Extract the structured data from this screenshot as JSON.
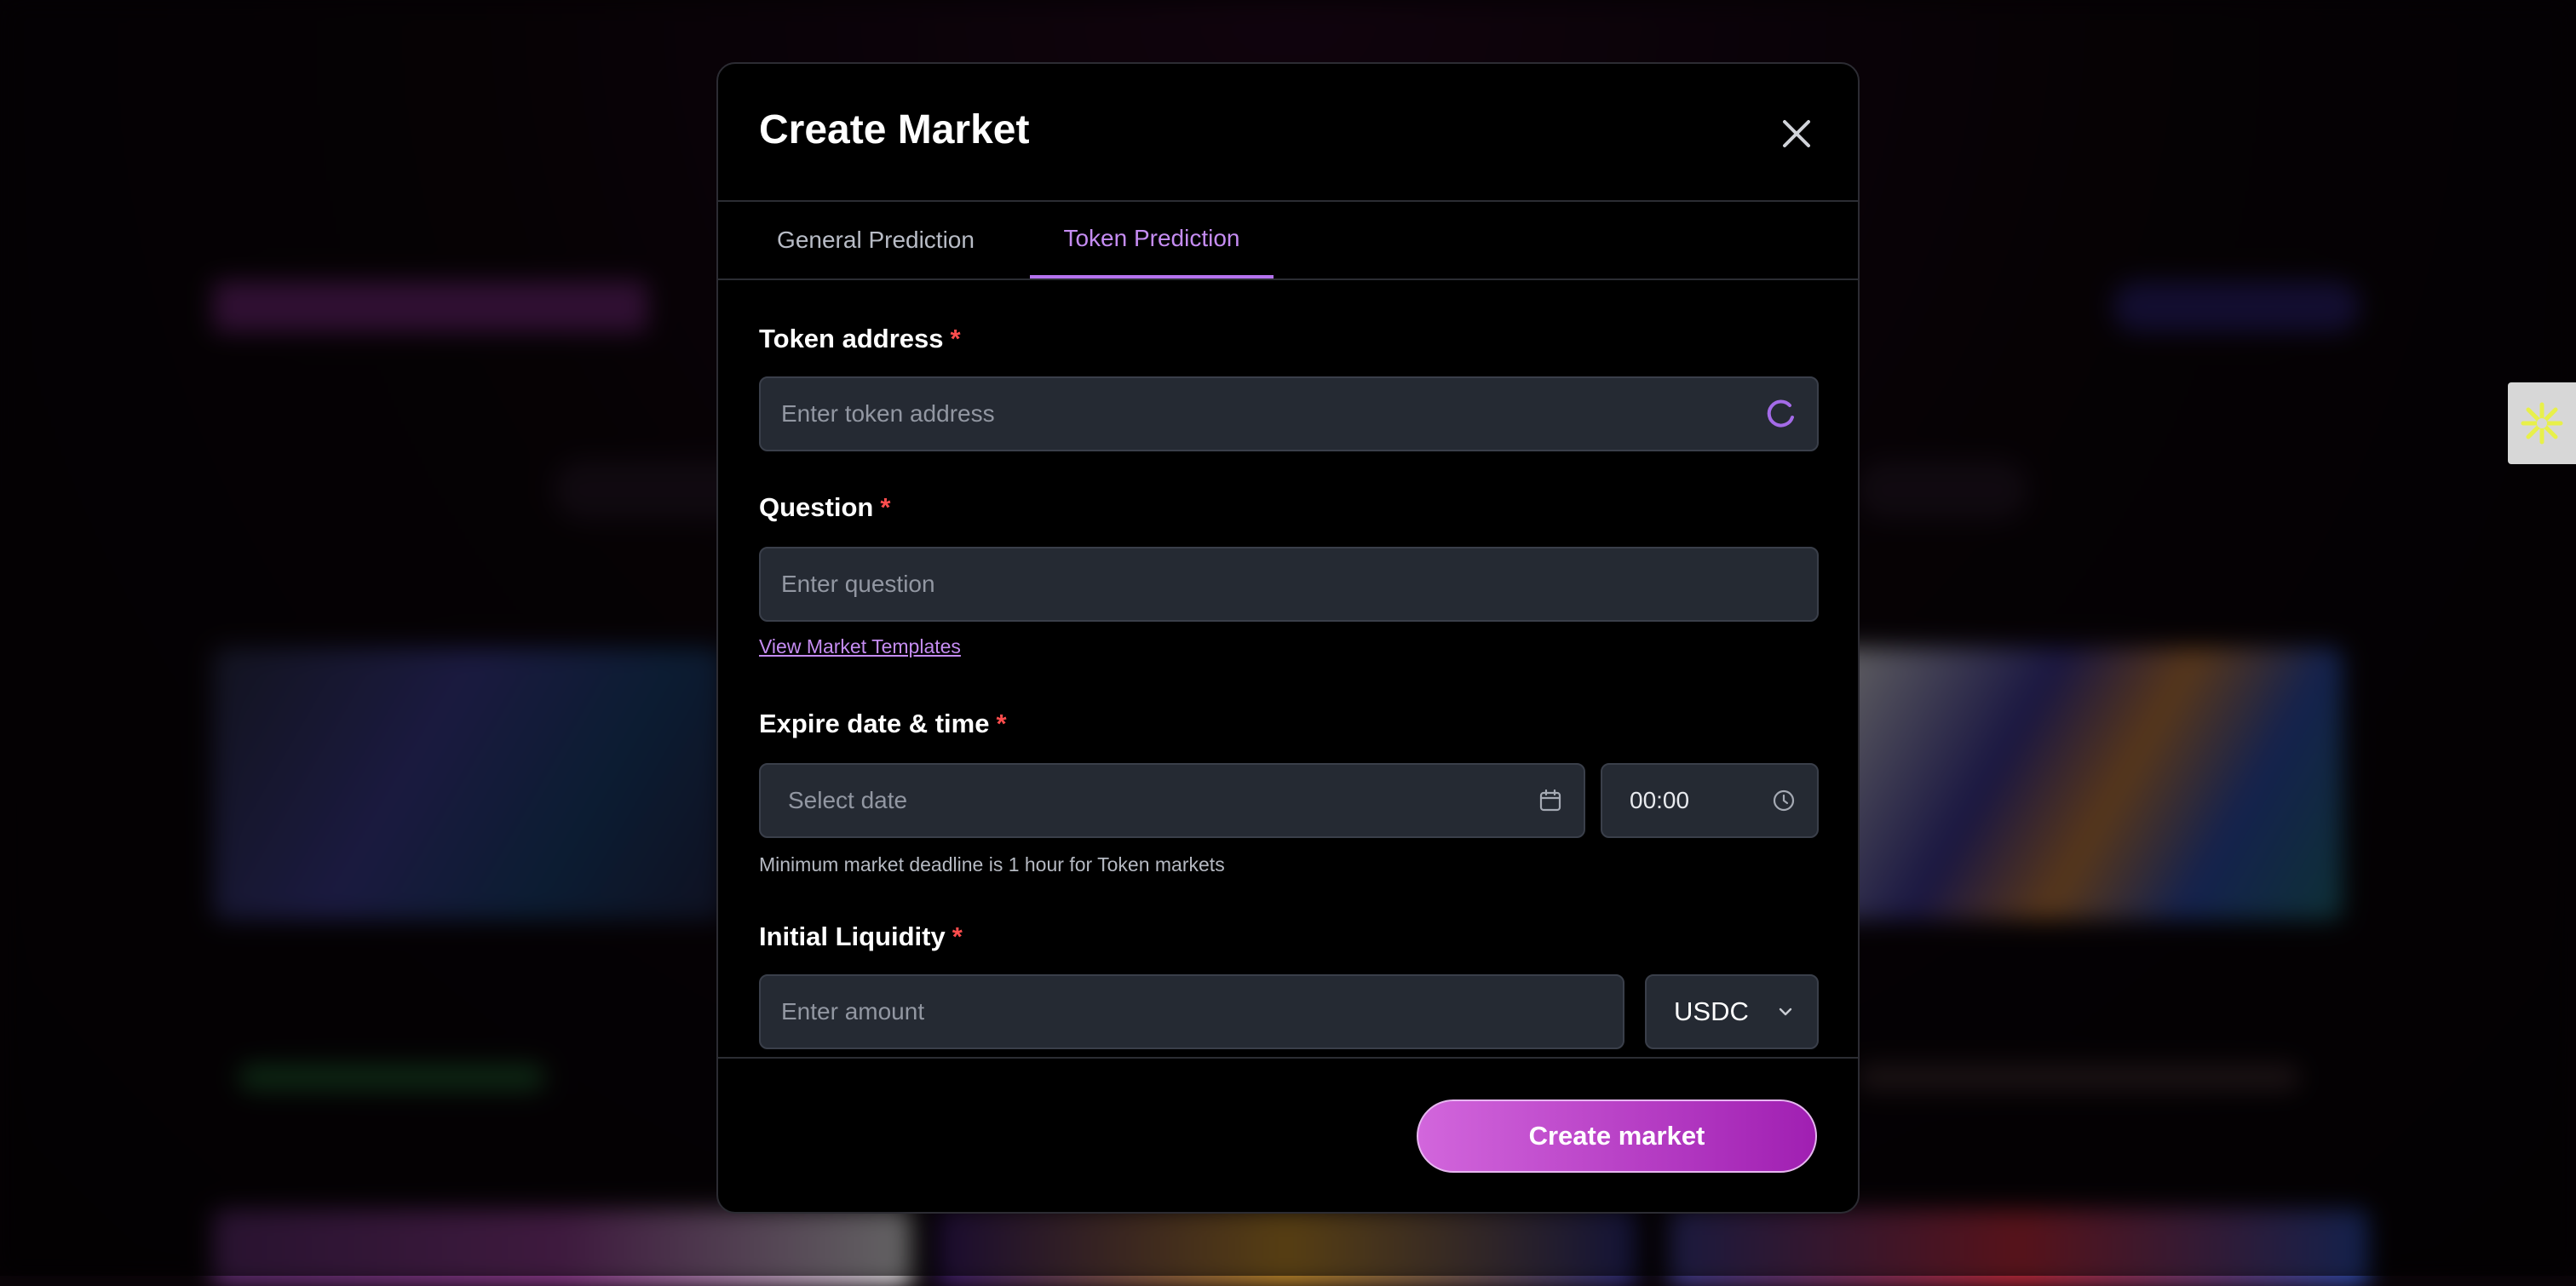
{
  "modal": {
    "title": "Create Market",
    "close_icon": "close-icon",
    "tabs": [
      {
        "label": "General Prediction",
        "active": false
      },
      {
        "label": "Token Prediction",
        "active": true
      }
    ]
  },
  "form": {
    "token_address": {
      "label": "Token address",
      "required_mark": "*",
      "placeholder": "Enter token address",
      "icon": "loading-spinner-icon"
    },
    "question": {
      "label": "Question",
      "required_mark": "*",
      "placeholder": "Enter question",
      "templates_link": "View Market Templates"
    },
    "expire": {
      "label": "Expire date & time",
      "required_mark": "*",
      "date_placeholder": "Select date",
      "date_icon": "calendar-icon",
      "time_value": "00:00",
      "time_icon": "clock-icon",
      "hint": "Minimum market deadline is 1 hour for Token markets"
    },
    "liquidity": {
      "label": "Initial Liquidity",
      "required_mark": "*",
      "placeholder": "Enter amount",
      "currency": "USDC",
      "currency_icon": "chevron-down-icon"
    }
  },
  "footer": {
    "submit_label": "Create market"
  },
  "side_widget": {
    "icon": "sparkle-icon"
  },
  "colors": {
    "accent": "#b472ee",
    "required": "#ff4d4d",
    "button_start": "#d266dc",
    "button_end": "#a01fb2",
    "field_bg": "#252a33"
  }
}
